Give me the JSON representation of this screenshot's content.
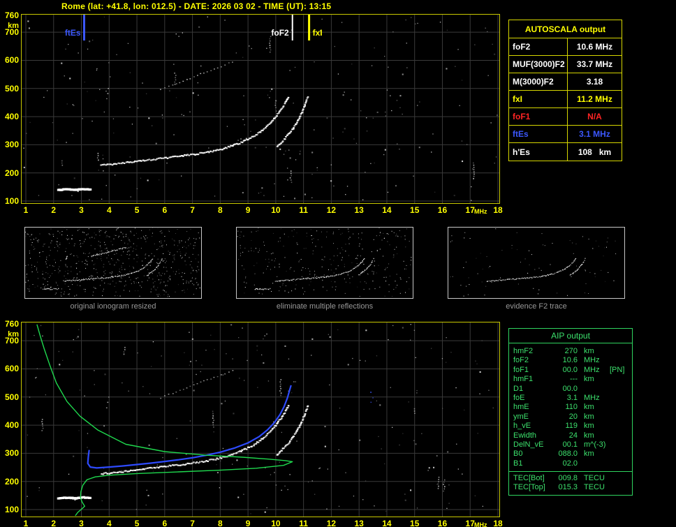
{
  "title": "Rome (lat: +41.8, lon: 012.5) - DATE: 2026 03 02 - TIME (UT): 13:15",
  "colors": {
    "yellow": "#ffff00",
    "plot_border": "#c9c900",
    "grid": "#3a3a3a",
    "trace_white": "#ffffff",
    "blue": "#3b57fb",
    "red": "#ff2424",
    "green": "#2fd45f",
    "caption_gray": "#989898"
  },
  "axes": {
    "x_ticks": [
      "1",
      "2",
      "3",
      "4",
      "5",
      "6",
      "7",
      "8",
      "9",
      "10",
      "11",
      "12",
      "13",
      "14",
      "15",
      "16",
      "17",
      "18"
    ],
    "x_unit": "MHz",
    "y_ticks": [
      "760",
      "700",
      "600",
      "500",
      "400",
      "300",
      "200",
      "100"
    ],
    "y_unit": "km"
  },
  "autoscala_table": {
    "header": "AUTOSCALA output",
    "rows": [
      {
        "label": "foF2",
        "value": "10.6 MHz",
        "color": "#ffffff"
      },
      {
        "label": "MUF(3000)F2",
        "value": "33.7 MHz",
        "color": "#ffffff"
      },
      {
        "label": "M(3000)F2",
        "value": "3.18",
        "color": "#ffffff"
      },
      {
        "label": "fxI",
        "value": "11.2 MHz",
        "color": "#ffff00"
      },
      {
        "label": "foF1",
        "value": "N/A",
        "color": "#ff2424"
      },
      {
        "label": "ftEs",
        "value": "3.1 MHz",
        "color": "#3b57fb"
      },
      {
        "label": "h'Es",
        "value": "108   km",
        "color": "#ffffff"
      }
    ]
  },
  "thumbnails": [
    {
      "caption": "original ionogram resized"
    },
    {
      "caption": "eliminate multiple reflections"
    },
    {
      "caption": "evidence F2 trace"
    }
  ],
  "aip_table": {
    "header": "AIP output",
    "rows": [
      {
        "label": "hmF2",
        "value": "270",
        "unit": "km",
        "extra": ""
      },
      {
        "label": "foF2",
        "value": "10.6",
        "unit": "MHz",
        "extra": ""
      },
      {
        "label": "foF1",
        "value": "00.0",
        "unit": "MHz",
        "extra": "[PN]"
      },
      {
        "label": "hmF1",
        "value": "---",
        "unit": "km",
        "extra": ""
      },
      {
        "label": "D1",
        "value": "00.0",
        "unit": "",
        "extra": ""
      },
      {
        "label": "foE",
        "value": "3.1",
        "unit": "MHz",
        "extra": ""
      },
      {
        "label": "hmE",
        "value": "110",
        "unit": "km",
        "extra": ""
      },
      {
        "label": "ymE",
        "value": "20",
        "unit": "km",
        "extra": ""
      },
      {
        "label": "h_vE",
        "value": "119",
        "unit": "km",
        "extra": ""
      },
      {
        "label": "Ewidth",
        "value": "24",
        "unit": "km",
        "extra": ""
      },
      {
        "label": "DelN_vE",
        "value": "00.1",
        "unit": "m^(-3)",
        "extra": ""
      },
      {
        "label": "B0",
        "value": "088.0",
        "unit": "km",
        "extra": ""
      },
      {
        "label": "B1",
        "value": "02.0",
        "unit": "",
        "extra": ""
      }
    ],
    "tec_rows": [
      {
        "label": "TEC[Bot]",
        "value": "009.8",
        "unit": "TECU"
      },
      {
        "label": "TEC[Top]",
        "value": "015.3",
        "unit": "TECU"
      }
    ]
  },
  "chart_data": [
    {
      "name": "main-ionogram",
      "type": "scatter",
      "xlabel": "MHz",
      "ylabel": "km",
      "xlim": [
        1,
        18
      ],
      "ylim": [
        100,
        760
      ],
      "grid": true,
      "noise_seed": 7,
      "noise_count": 235,
      "markers": [
        {
          "label": "ftEs",
          "freq": 3.1,
          "color": "#3b57fb",
          "side": "left",
          "width": 3
        },
        {
          "label": "foF2",
          "freq": 10.6,
          "color": "#ffffff",
          "side": "left",
          "width": 2
        },
        {
          "label": "fxI",
          "freq": 11.2,
          "color": "#ffff00",
          "side": "right",
          "width": 3
        }
      ],
      "series": [
        {
          "name": "Es-trace",
          "style": "dots-bar",
          "color": "#ffffff",
          "points": [
            [
              2.18,
              138
            ],
            [
              2.5,
              141
            ],
            [
              2.8,
              139
            ],
            [
              3.05,
              142
            ],
            [
              3.32,
              140
            ]
          ]
        },
        {
          "name": "F-trace-ordinary",
          "style": "dots-thick",
          "color": "#ffffff",
          "points": [
            [
              3.72,
              226
            ],
            [
              4.0,
              229
            ],
            [
              4.5,
              234
            ],
            [
              5.0,
              240
            ],
            [
              5.5,
              246
            ],
            [
              6.0,
              252
            ],
            [
              6.5,
              258
            ],
            [
              7.0,
              264
            ],
            [
              7.5,
              272
            ],
            [
              8.0,
              282
            ],
            [
              8.4,
              294
            ],
            [
              8.8,
              309
            ],
            [
              9.2,
              328
            ],
            [
              9.5,
              349
            ],
            [
              9.8,
              376
            ],
            [
              10.0,
              399
            ],
            [
              10.2,
              425
            ],
            [
              10.35,
              449
            ],
            [
              10.45,
              468
            ]
          ]
        },
        {
          "name": "F-trace-extraordinary",
          "style": "dots-thick",
          "color": "#ffffff",
          "points": [
            [
              10.05,
              292
            ],
            [
              10.3,
              318
            ],
            [
              10.6,
              352
            ],
            [
              10.85,
              392
            ],
            [
              11.0,
              426
            ],
            [
              11.1,
              452
            ],
            [
              11.16,
              468
            ]
          ]
        },
        {
          "name": "multiple-reflection",
          "style": "dots-sparse",
          "color": "#c0c0c0",
          "points": [
            [
              5.85,
              497
            ],
            [
              6.3,
              513
            ],
            [
              6.8,
              531
            ],
            [
              7.3,
              551
            ],
            [
              7.9,
              573
            ],
            [
              8.45,
              594
            ]
          ]
        },
        {
          "name": "Es-second-echo",
          "style": "dots-sparse",
          "color": "#b8b8b8",
          "points": [
            [
              3.92,
              462
            ],
            [
              3.95,
              480
            ],
            [
              3.98,
              500
            ]
          ]
        }
      ]
    },
    {
      "name": "autoscaled-ionogram-with-profile",
      "type": "scatter",
      "xlabel": "MHz",
      "ylabel": "km",
      "xlim": [
        1,
        18
      ],
      "ylim": [
        100,
        760
      ],
      "grid": true,
      "noise_seed": 13,
      "noise_count": 215,
      "markers": [],
      "series": [
        {
          "name": "Es-trace",
          "style": "dots-bar",
          "color": "#ffffff",
          "points": [
            [
              2.18,
              138
            ],
            [
              2.5,
              141
            ],
            [
              2.8,
              139
            ],
            [
              3.05,
              142
            ],
            [
              3.32,
              140
            ]
          ]
        },
        {
          "name": "F-trace-ordinary",
          "style": "dots-thick",
          "color": "#ffffff",
          "points": [
            [
              3.72,
              226
            ],
            [
              4.0,
              229
            ],
            [
              4.5,
              234
            ],
            [
              5.0,
              240
            ],
            [
              5.5,
              246
            ],
            [
              6.0,
              252
            ],
            [
              6.5,
              258
            ],
            [
              7.0,
              264
            ],
            [
              7.5,
              272
            ],
            [
              8.0,
              282
            ],
            [
              8.4,
              294
            ],
            [
              8.8,
              309
            ],
            [
              9.2,
              328
            ],
            [
              9.5,
              349
            ],
            [
              9.8,
              376
            ],
            [
              10.0,
              399
            ],
            [
              10.2,
              425
            ],
            [
              10.35,
              449
            ],
            [
              10.45,
              468
            ]
          ]
        },
        {
          "name": "F-trace-extraordinary",
          "style": "dots-thick",
          "color": "#ffffff",
          "points": [
            [
              10.05,
              292
            ],
            [
              10.3,
              318
            ],
            [
              10.6,
              352
            ],
            [
              10.85,
              392
            ],
            [
              11.0,
              426
            ],
            [
              11.1,
              452
            ],
            [
              11.16,
              468
            ]
          ]
        },
        {
          "name": "multiple-reflection",
          "style": "dots-sparse",
          "color": "#a8a8a8",
          "points": [
            [
              5.85,
              497
            ],
            [
              6.3,
              513
            ],
            [
              6.8,
              531
            ],
            [
              7.3,
              551
            ],
            [
              7.9,
              573
            ],
            [
              8.45,
              594
            ]
          ]
        },
        {
          "name": "Es-second-echo",
          "style": "dots-sparse",
          "color": "#a8a8a8",
          "points": [
            [
              3.92,
              462
            ],
            [
              3.95,
              480
            ],
            [
              3.98,
              500
            ]
          ]
        },
        {
          "name": "blue-speckle",
          "style": "dots-sparse",
          "color": "#3b57fb",
          "points": [
            [
              13.42,
              516
            ],
            [
              13.5,
              498
            ],
            [
              13.44,
              480
            ]
          ]
        },
        {
          "name": "autoscala-fitted-trace",
          "style": "line",
          "color": "#2e4bff",
          "width": 2.2,
          "points": [
            [
              3.28,
              312
            ],
            [
              3.25,
              288
            ],
            [
              3.23,
              264
            ],
            [
              3.32,
              251
            ],
            [
              3.55,
              248
            ],
            [
              4.0,
              251
            ],
            [
              4.5,
              255
            ],
            [
              5.0,
              260
            ],
            [
              5.5,
              265
            ],
            [
              6.0,
              271
            ],
            [
              6.5,
              277
            ],
            [
              7.0,
              284
            ],
            [
              7.5,
              293
            ],
            [
              8.0,
              304
            ],
            [
              8.5,
              318
            ],
            [
              9.0,
              337
            ],
            [
              9.4,
              359
            ],
            [
              9.7,
              383
            ],
            [
              9.95,
              409
            ],
            [
              10.15,
              437
            ],
            [
              10.3,
              466
            ],
            [
              10.42,
              497
            ],
            [
              10.5,
              525
            ],
            [
              10.55,
              542
            ]
          ]
        },
        {
          "name": "electron-density-profile",
          "style": "line",
          "color": "#1fd94e",
          "width": 1.4,
          "points": [
            [
              1.4,
              758
            ],
            [
              1.52,
              716
            ],
            [
              1.66,
              672
            ],
            [
              1.86,
              614
            ],
            [
              2.1,
              550
            ],
            [
              2.48,
              484
            ],
            [
              2.95,
              432
            ],
            [
              3.6,
              382
            ],
            [
              4.6,
              332
            ],
            [
              6.0,
              306
            ],
            [
              7.5,
              293
            ],
            [
              8.8,
              286
            ],
            [
              9.8,
              279
            ],
            [
              10.35,
              274
            ],
            [
              10.6,
              270
            ],
            [
              10.28,
              257
            ],
            [
              9.3,
              247
            ],
            [
              8.0,
              240
            ],
            [
              6.5,
              234
            ],
            [
              5.0,
              228
            ],
            [
              4.0,
              222
            ],
            [
              3.5,
              216
            ],
            [
              3.2,
              206
            ],
            [
              3.05,
              186
            ],
            [
              2.98,
              162
            ],
            [
              2.97,
              142
            ],
            [
              3.03,
              126
            ],
            [
              3.12,
              112
            ],
            [
              3.0,
              101
            ],
            [
              2.87,
              90
            ],
            [
              2.78,
              78
            ]
          ]
        }
      ]
    }
  ]
}
